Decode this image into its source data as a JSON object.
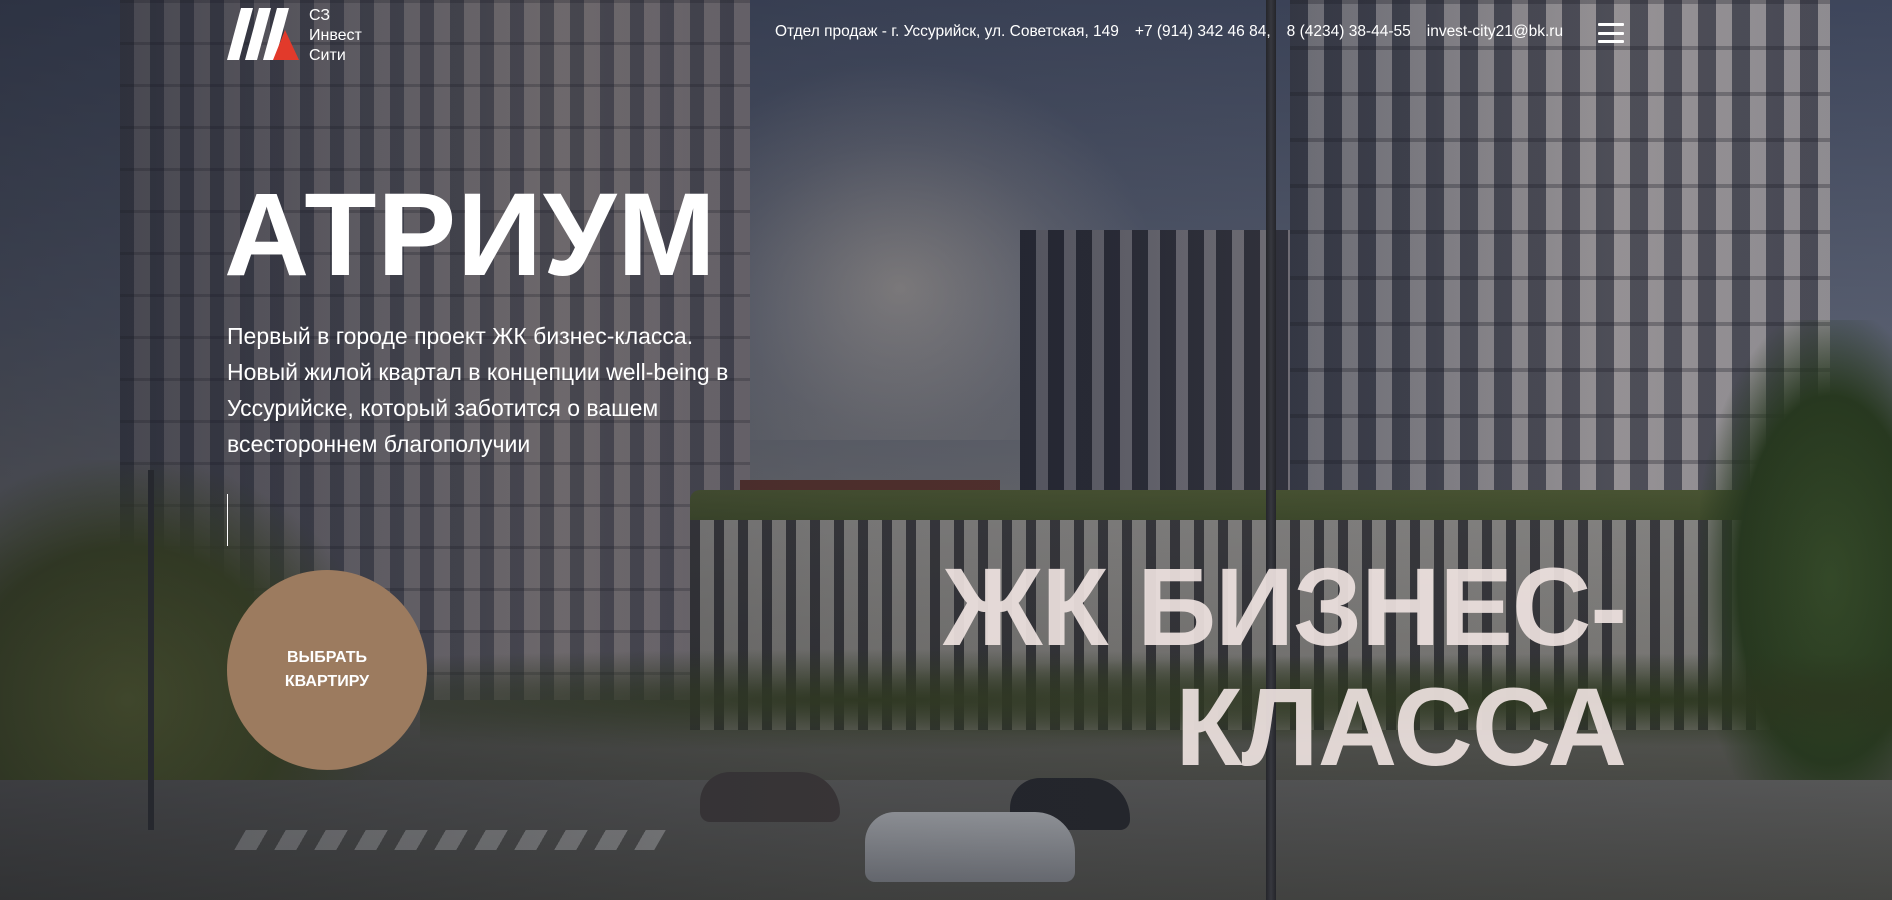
{
  "logo": {
    "line1": "СЗ",
    "line2": "Инвест",
    "line3": "Сити",
    "accent_color": "#e23a2b"
  },
  "header": {
    "sales_office": "Отдел продаж - г. Уссурийск, ул. Советская, 149",
    "phone1": "+7 (914) 342 46 84,",
    "phone2": "8 (4234) 38-44-55",
    "email": "invest-city21@bk.ru",
    "menu_icon": "hamburger-menu-icon"
  },
  "hero": {
    "title": "АТРИУМ",
    "subtitle": "Первый в городе проект ЖК бизнес-класса. Новый жилой квартал в концепции well-being в Уссурийске, который заботится о вашем всестороннем благополучии",
    "cta_label": "ВЫБРАТЬ КВАРТИРУ",
    "cta_color": "#9c7b5f",
    "tagline_line1": "ЖК БИЗНЕС-",
    "tagline_line2": "КЛАССА"
  }
}
